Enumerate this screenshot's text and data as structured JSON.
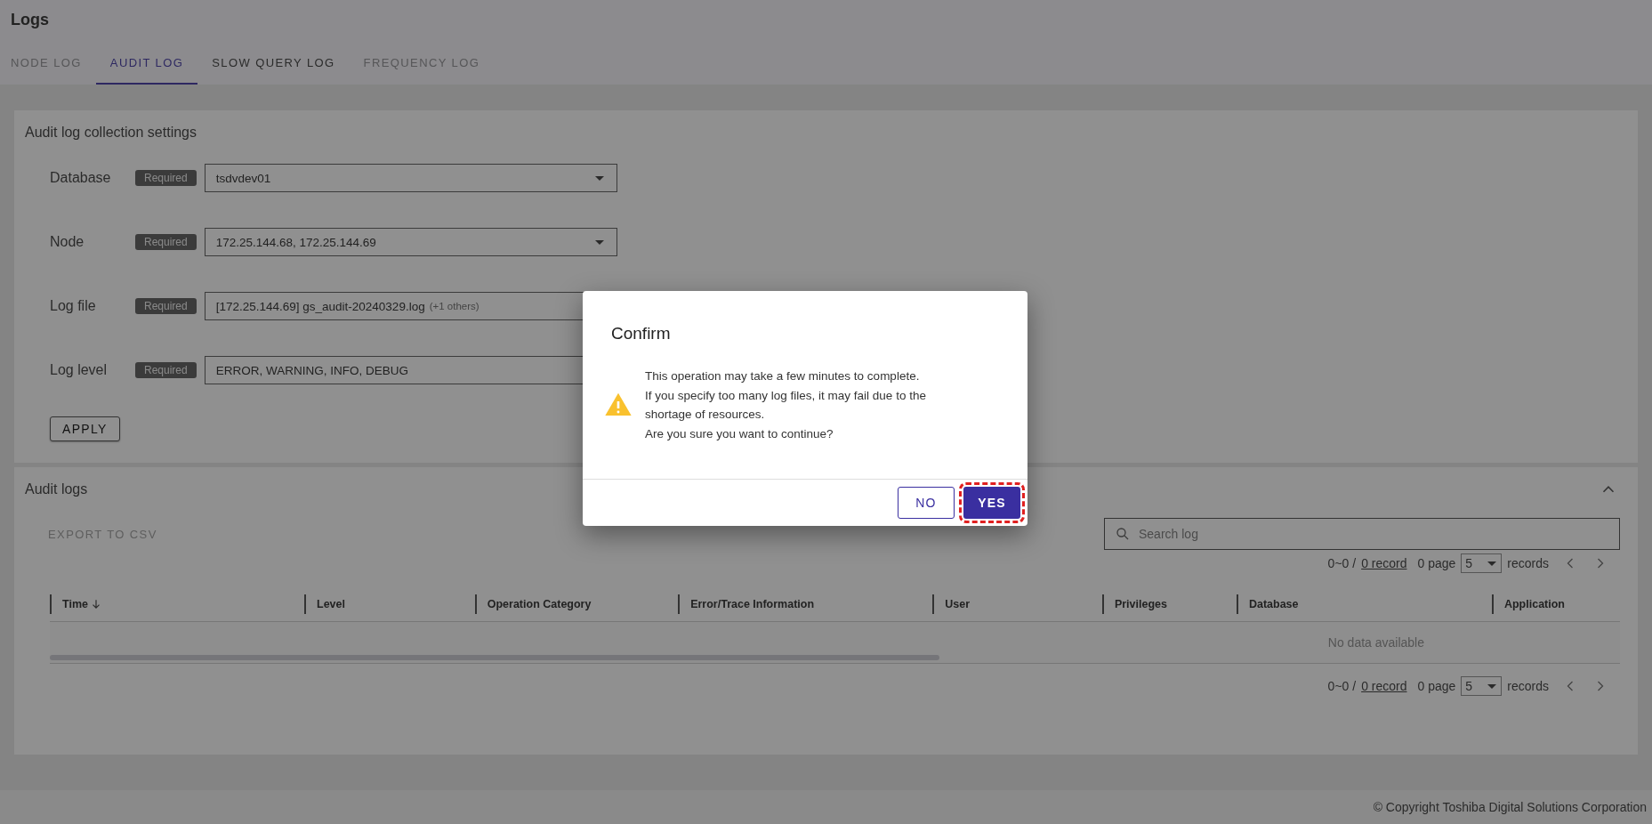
{
  "page": {
    "title": "Logs"
  },
  "tabs": [
    {
      "label": "NODE LOG",
      "selected": false,
      "disabled": true
    },
    {
      "label": "AUDIT LOG",
      "selected": true,
      "disabled": false
    },
    {
      "label": "SLOW QUERY LOG",
      "selected": false,
      "disabled": false
    },
    {
      "label": "FREQUENCY LOG",
      "selected": false,
      "disabled": true
    }
  ],
  "settings": {
    "title": "Audit log collection settings",
    "fields": [
      {
        "label": "Database",
        "badge": "Required",
        "value": "tsdvdev01",
        "kind": "select"
      },
      {
        "label": "Node",
        "badge": "Required",
        "value": "172.25.144.68, 172.25.144.69",
        "kind": "select"
      },
      {
        "label": "Log file",
        "badge": "Required",
        "value": "[172.25.144.69] gs_audit-20240329.log",
        "extra": "(+1 others)",
        "kind": "clearable"
      },
      {
        "label": "Log level",
        "badge": "Required",
        "value": "ERROR, WARNING, INFO, DEBUG",
        "kind": "plain"
      }
    ],
    "apply_button": "APPLY"
  },
  "audit_logs": {
    "title": "Audit logs",
    "expanded": true,
    "export_button": {
      "label": "EXPORT TO CSV",
      "disabled": true
    },
    "search": {
      "placeholder": "Search log"
    },
    "pagination_top": {
      "range": "0~0 /",
      "total": "0 record",
      "pages": "0 page",
      "per_page": "5",
      "unit": "records"
    },
    "table": {
      "columns": [
        {
          "label": "Time",
          "sorted": true,
          "descending": true
        },
        {
          "label": "Level"
        },
        {
          "label": "Operation Category"
        },
        {
          "label": "Error/Trace Information"
        },
        {
          "label": "User"
        },
        {
          "label": "Privileges"
        },
        {
          "label": "Database"
        },
        {
          "label": "Application"
        }
      ],
      "empty_text": "No data available"
    },
    "pagination_bottom": {
      "range": "0~0 /",
      "total": "0 record",
      "pages": "0 page",
      "per_page": "5",
      "unit": "records"
    }
  },
  "dialog": {
    "title": "Confirm",
    "kind": "warning",
    "message": "This operation may take a few minutes to complete.\nIf you specify too many log files, it may fail due to the\nshortage of resources.\nAre you sure you want to continue?",
    "buttons": [
      {
        "label": "NO",
        "kind": "outlined",
        "highlighted": false
      },
      {
        "label": "YES",
        "kind": "filled",
        "highlighted": true
      }
    ]
  },
  "footer": {
    "copyright": "© Copyright Toshiba Digital Solutions Corporation"
  }
}
